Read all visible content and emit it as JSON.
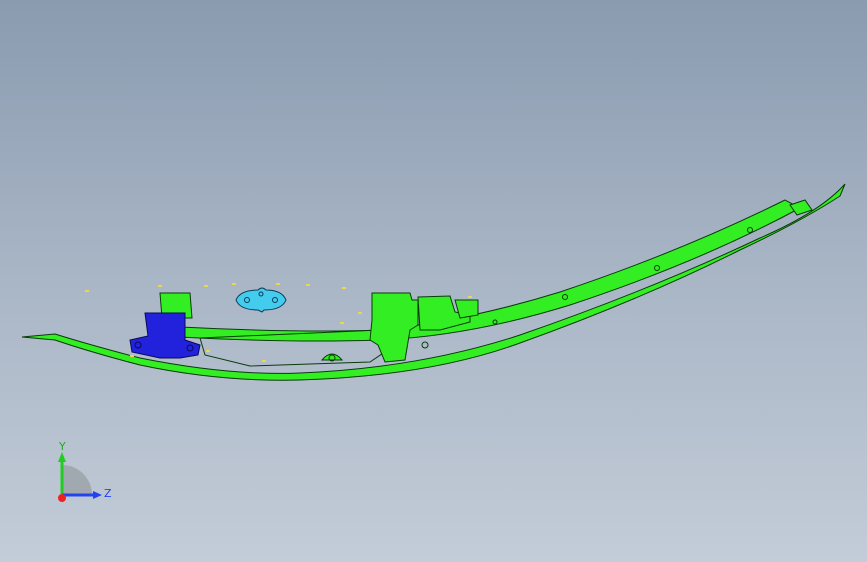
{
  "viewport": {
    "background_top": "#8a9bb0",
    "background_bottom": "#c3ccd8"
  },
  "model": {
    "main_part_color": "#33ee22",
    "bracket_color": "#2222dd",
    "clip_color": "#44ccee",
    "edge_color": "#0a3a0a"
  },
  "triad": {
    "y_label": "Y",
    "z_label": "Z",
    "y_color": "#22cc22",
    "z_color": "#2244ee",
    "x_color": "#ee2222"
  }
}
